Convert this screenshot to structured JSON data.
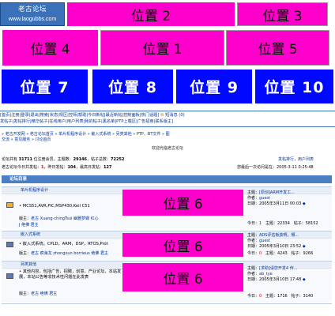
{
  "site": {
    "logo_top": "老古论坛",
    "logo_bottom": "www.laogubbs.com"
  },
  "ads": {
    "p2": "位置 2",
    "p3": "位置 3",
    "p4": "位置 4",
    "p1": "位置 1",
    "p5": "位置 5",
    "p7": "位置 7",
    "p8": "位置 8",
    "p9": "位置 9",
    "p10": "位置 10",
    "p6a": "位置 6",
    "p6b": "位置 6",
    "p6c": "位置 6"
  },
  "menu": {
    "line1": "[首页|注册|登录|退出|搜索|状态|规区|控师|帮助|今日新帖|最近新帖|控制面板|热门话题]",
    "line1_tail": "短消息 (0)",
    "line2": "发帖子|发帖排行|精华帖子|在线用户|用户列表|我的帖子|黑名单|PTP上载区|广告招商|联系版主]"
  },
  "breadcrumb": {
    "line1": "» 老古开发网 » 老古论坛首页 » 单片机程序设计 » 嵌入式系统 » 另类其他 » PTP、BT文件 » 图",
    "line2": "交流 » 意见服务 » 讨论首页"
  },
  "links": {
    "rank": "发帖排行",
    "users": "用户列表"
  },
  "welcome": "欢迎光临老古论坛",
  "stats": {
    "line1_a": "论坛共有",
    "members": "31711",
    "line1_b": "位注册会员，主题数：",
    "topics": "29146",
    "line1_c": "，帖子总数：",
    "posts": "72252",
    "line2_a": "老古论坛今日共发帖：",
    "today": "1",
    "line2_b": "，昨日发帖：",
    "yesterday": "104",
    "line2_c": "，最高日发帖：",
    "max": "127",
    "last_visit": "您最后一次访问是在：2005-3-11 0:25:48"
  },
  "forum_header": "论坛目录",
  "forums": [
    {
      "title": "单片机程序设计",
      "desc": "MCS51,AVR,PIC,MSP430,Keil C51",
      "mods_label": "版主：",
      "mods": "老古 Xuang-chingTsui 幽雅梦蝶 红心",
      "mods2": "J 绝佛 君主",
      "topic_label": "主题：",
      "topic": "[原创]ARM开发工...",
      "author_label": "作者：",
      "author": "guest",
      "date_label": "日期：",
      "date": "2005年3月11日 00:03",
      "today_label": "今日：",
      "today": "1",
      "topics_label": "主题：",
      "topics": "22334",
      "posts_label": "帖子：",
      "posts": "58152"
    },
    {
      "title": "嵌入式系统",
      "desc": "嵌入式系统，CPLD，ARM，DSP，RTOS,Prot",
      "mods_label": "版主：",
      "mods": "老古 疯海龙 zhongxun borrieus 绝佛 君主",
      "mods2": "",
      "topic_label": "主题：",
      "topic": "ADS评估板获啊，哪...",
      "author_label": "作者：",
      "author": "guest",
      "date_label": "日期：",
      "date": "2005年3月10日 23:52",
      "today_label": "今日：",
      "today": "0",
      "topics_label": "主题：",
      "topics": "4243",
      "posts_label": "帖子：",
      "posts": "9266"
    },
    {
      "title": "另类其他",
      "desc": "其他内容，包括广告，招聘，创意，产业论坛，本站发展，本站公告等非技术性问题在此发表",
      "mods_label": "版主：",
      "mods": "老古 绝佛 君主",
      "mods2": "",
      "topic_label": "主题：",
      "topic": "[求助]请您开发4 传...",
      "author_label": "作者：",
      "author": "ab_tye",
      "date_label": "日期：",
      "date": "2005年3月10日 17:48",
      "today_label": "今日：",
      "today": "0",
      "topics_label": "主题：",
      "topics": "1716",
      "posts_label": "帖子：",
      "posts": "3140"
    }
  ],
  "colors": {
    "magenta": "#ff00cc",
    "blue_banner": "#0008ff",
    "link": "#003399",
    "header": "#4a7fc4"
  }
}
